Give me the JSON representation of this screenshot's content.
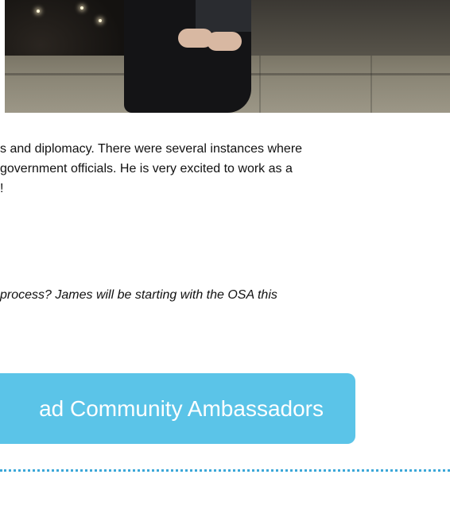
{
  "article": {
    "photo_alt": "photo",
    "lines": [
      "s and diplomacy. There were several instances where",
      "government officials.  He is very excited to work as a",
      "!"
    ],
    "italic_line": "process? James will be starting with the OSA this"
  },
  "cta": {
    "label": "ad Community Ambassadors",
    "color": "#5bc4e8"
  },
  "divider": {
    "color": "#3ca7d8",
    "style": "dotted"
  }
}
